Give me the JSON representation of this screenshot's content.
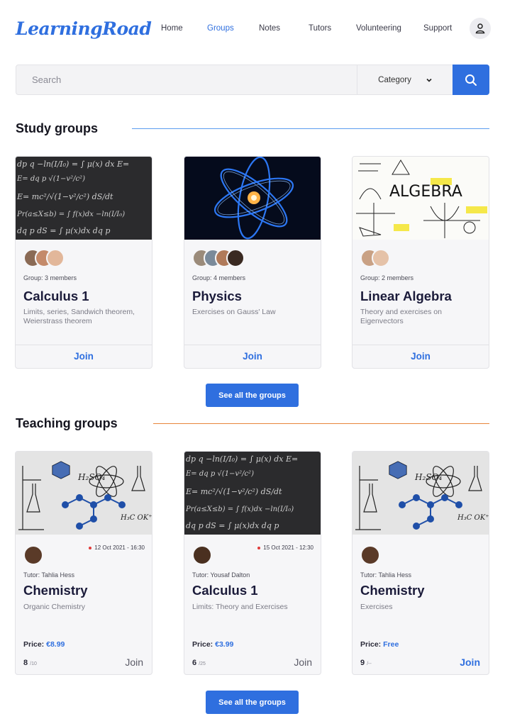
{
  "brand": {
    "name": "LearningRoad",
    "color": "#2f6fdf"
  },
  "nav": {
    "items": [
      {
        "label": "Home",
        "active": false
      },
      {
        "label": "Groups",
        "active": true
      },
      {
        "label": "Notes",
        "active": false
      },
      {
        "label": "Tutors",
        "active": false
      },
      {
        "label": "Volunteering",
        "active": false
      },
      {
        "label": "Support",
        "active": false
      }
    ],
    "profile_icon": "user-icon"
  },
  "search": {
    "placeholder": "Search",
    "value": "",
    "category_label": "Category",
    "button_icon": "search-icon"
  },
  "study_groups": {
    "heading": "Study groups",
    "line_color": "#5b9cf0",
    "cards": [
      {
        "image": "math-formulas-blackboard",
        "members_text": "Group: 3 members",
        "title": "Calculus 1",
        "description": "Limits, series, Sandwich theorem, Weierstrass theorem",
        "join_label": "Join"
      },
      {
        "image": "atom-glow",
        "members_text": "Group: 4 members",
        "title": "Physics",
        "description": "Exercises on Gauss' Law",
        "join_label": "Join"
      },
      {
        "image": "algebra-sketch",
        "members_text": "Group: 2 members",
        "title": "Linear Algebra",
        "description": "Theory and exercises on Eigenvectors",
        "join_label": "Join"
      }
    ],
    "see_all_label": "See all the groups"
  },
  "teaching_groups": {
    "heading": "Teaching groups",
    "line_color": "#e8843a",
    "cards": [
      {
        "image": "chemistry-sketch",
        "date": "12 Oct 2021 - 16:30",
        "tutor": "Tutor: Tahlia Hess",
        "title": "Chemistry",
        "description": "Organic Chemistry",
        "price_label": "Price:",
        "price": "€8.99",
        "seats": "8",
        "seats_total": "/10",
        "join_label": "Join",
        "join_highlight": false
      },
      {
        "image": "math-formulas-blackboard",
        "date": "15 Oct 2021 - 12:30",
        "tutor": "Tutor: Yousaf Dalton",
        "title": "Calculus 1",
        "description": "Limits: Theory and Exercises",
        "price_label": "Price:",
        "price": "€3.99",
        "seats": "6",
        "seats_total": "/25",
        "join_label": "Join",
        "join_highlight": false
      },
      {
        "image": "chemistry-sketch",
        "date": "",
        "tutor": "Tutor: Tahlia Hess",
        "title": "Chemistry",
        "description": "Exercises",
        "price_label": "Price:",
        "price": "Free",
        "seats": "9",
        "seats_total": "/--",
        "join_label": "Join",
        "join_highlight": true
      }
    ],
    "see_all_label": "See all the groups"
  }
}
